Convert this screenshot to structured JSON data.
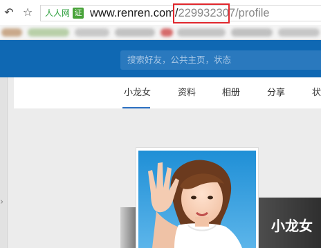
{
  "browser": {
    "back_icon": "↶",
    "star_icon": "☆",
    "site_name": "人人网",
    "cert_label": "证",
    "url_domain": "www.renren.com/",
    "url_uid": "229932307",
    "url_path": "/profile"
  },
  "header": {
    "search_placeholder": "搜索好友，公共主页，状态"
  },
  "tabs": [
    {
      "label": "小龙女"
    },
    {
      "label": "资料"
    },
    {
      "label": "相册"
    },
    {
      "label": "分享"
    },
    {
      "label": "状"
    }
  ],
  "profile": {
    "name": "小龙女"
  },
  "left_chevron": "›",
  "colors": {
    "header_blue": "#0f68b3",
    "highlight_red": "#e0262c",
    "active_tab_line": "#2b6fc1"
  }
}
